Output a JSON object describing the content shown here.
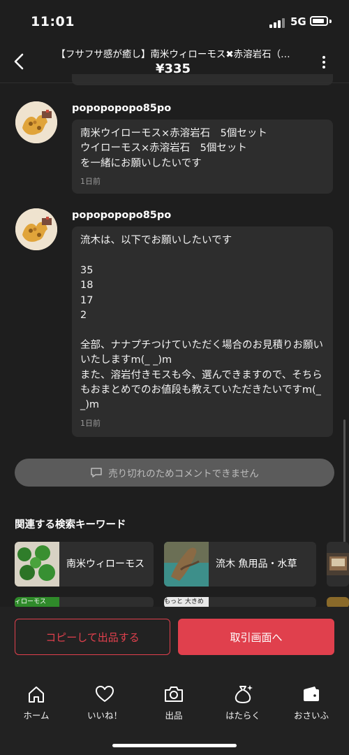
{
  "status_bar": {
    "time": "11:01",
    "network": "5G"
  },
  "header": {
    "title": "【フサフサ感が癒し】南米ウィローモス✖赤溶岩石（…",
    "price": "¥335"
  },
  "comments": [
    {
      "username": "popopopopo85po",
      "text": "南米ウイローモス×赤溶岩石　5個セット\nウイローモス×赤溶岩石　5個セット\nを一緒にお願いしたいです",
      "time": "1日前"
    },
    {
      "username": "popopopopo85po",
      "text": "流木は、以下でお願いしたいです\n\n35\n18\n17\n2\n\n全部、ナナプチつけていただく場合のお見積りお願いいたしますm(_ _)m\nまた、溶岩付きモスも今、選んできますので、そちらもおまとめでのお値段も教えていただきたいですm(_ _)m",
      "time": "1日前"
    }
  ],
  "comment_bar": {
    "text": "売り切れのためコメントできません",
    "icon": "comment-icon"
  },
  "keywords": {
    "title": "関連する検索キーワード",
    "items": [
      {
        "label": "南米ウィローモス"
      },
      {
        "label": "流木 魚用品・水草"
      },
      {
        "label": ""
      },
      {
        "label": ""
      },
      {
        "label": ""
      },
      {
        "label": ""
      }
    ],
    "thumb_texts": [
      "ィローモス",
      "もっと 大きめ"
    ]
  },
  "actions": {
    "copy": "コピーして出品する",
    "trade": "取引画面へ"
  },
  "tabs": [
    {
      "label": "ホーム",
      "icon": "home-icon"
    },
    {
      "label": "いいね！",
      "icon": "heart-icon"
    },
    {
      "label": "出品",
      "icon": "camera-icon"
    },
    {
      "label": "はたらく",
      "icon": "money-bag-icon"
    },
    {
      "label": "おさいふ",
      "icon": "wallet-icon"
    }
  ],
  "colors": {
    "accent": "#e0404d",
    "background": "#1e1e1e",
    "bubble": "#2d2d2d"
  }
}
